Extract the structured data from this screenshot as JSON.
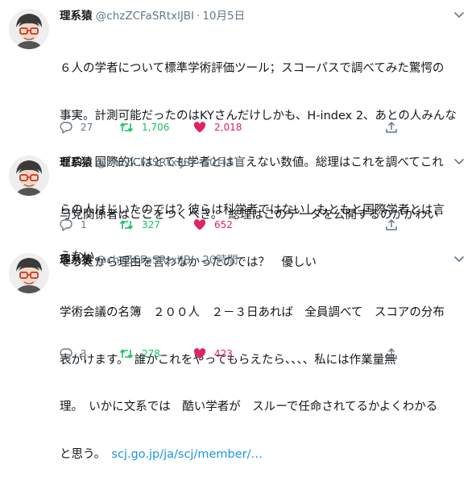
{
  "tweets": [
    {
      "name": "理系猿",
      "handle": "@chzZCFaSRtxlJBI",
      "dot": "·",
      "time": "10月5日",
      "lines": [
        "６人の学者について標準学術評価ツール；スコーパスで調べてみた驚愕の",
        "事実。計測可能だったのはKYさんだけしかも、H-index 2、あとの人みんな",
        "ゼロ。国際的にはとても学者とは言えない数値。総理はこれを調べてこれ",
        "らの人はじいたのでは？彼らは科学者ではないしもともと国際学者とは言",
        "えない。"
      ],
      "replies": "27",
      "retweets": "1,706",
      "likes": "2,018"
    },
    {
      "name": "理系猿",
      "handle": "@chzZCFaSRtxlJBI",
      "dot": "·",
      "time": "10月5日",
      "lines": [
        "与党関係者はここをつくべき。　総理はこのデータを公開するのがかわい",
        "そうだから理由を言わなかったのでは？　優しい"
      ],
      "replies": "1",
      "retweets": "327",
      "likes": "652"
    },
    {
      "name": "理系猿",
      "handle": "@chzZCFaSRtxlJBI",
      "dot": "·",
      "time": "20時間",
      "lines": [
        "学術会議の名簿　２００人　２－３日あれば　全員調べて　スコアの分布",
        "表がけます。　誰かこれをやってもらえたら、、、、私には作業量無",
        "理。　いかに文系では　酷い学者が　スルーで任命されてるかよくわかる",
        "と思う。　"
      ],
      "link": "scj.go.jp/ja/scj/member/…",
      "replies": "3",
      "retweets": "278",
      "likes": "423"
    }
  ],
  "colors": {
    "reply": "#657786",
    "retweet": "#17bf63",
    "like": "#e0245e",
    "link": "#1b95e0"
  },
  "icons": [
    "avatar-icon",
    "caret-down-icon",
    "reply-icon",
    "retweet-icon",
    "heart-icon",
    "share-icon"
  ]
}
